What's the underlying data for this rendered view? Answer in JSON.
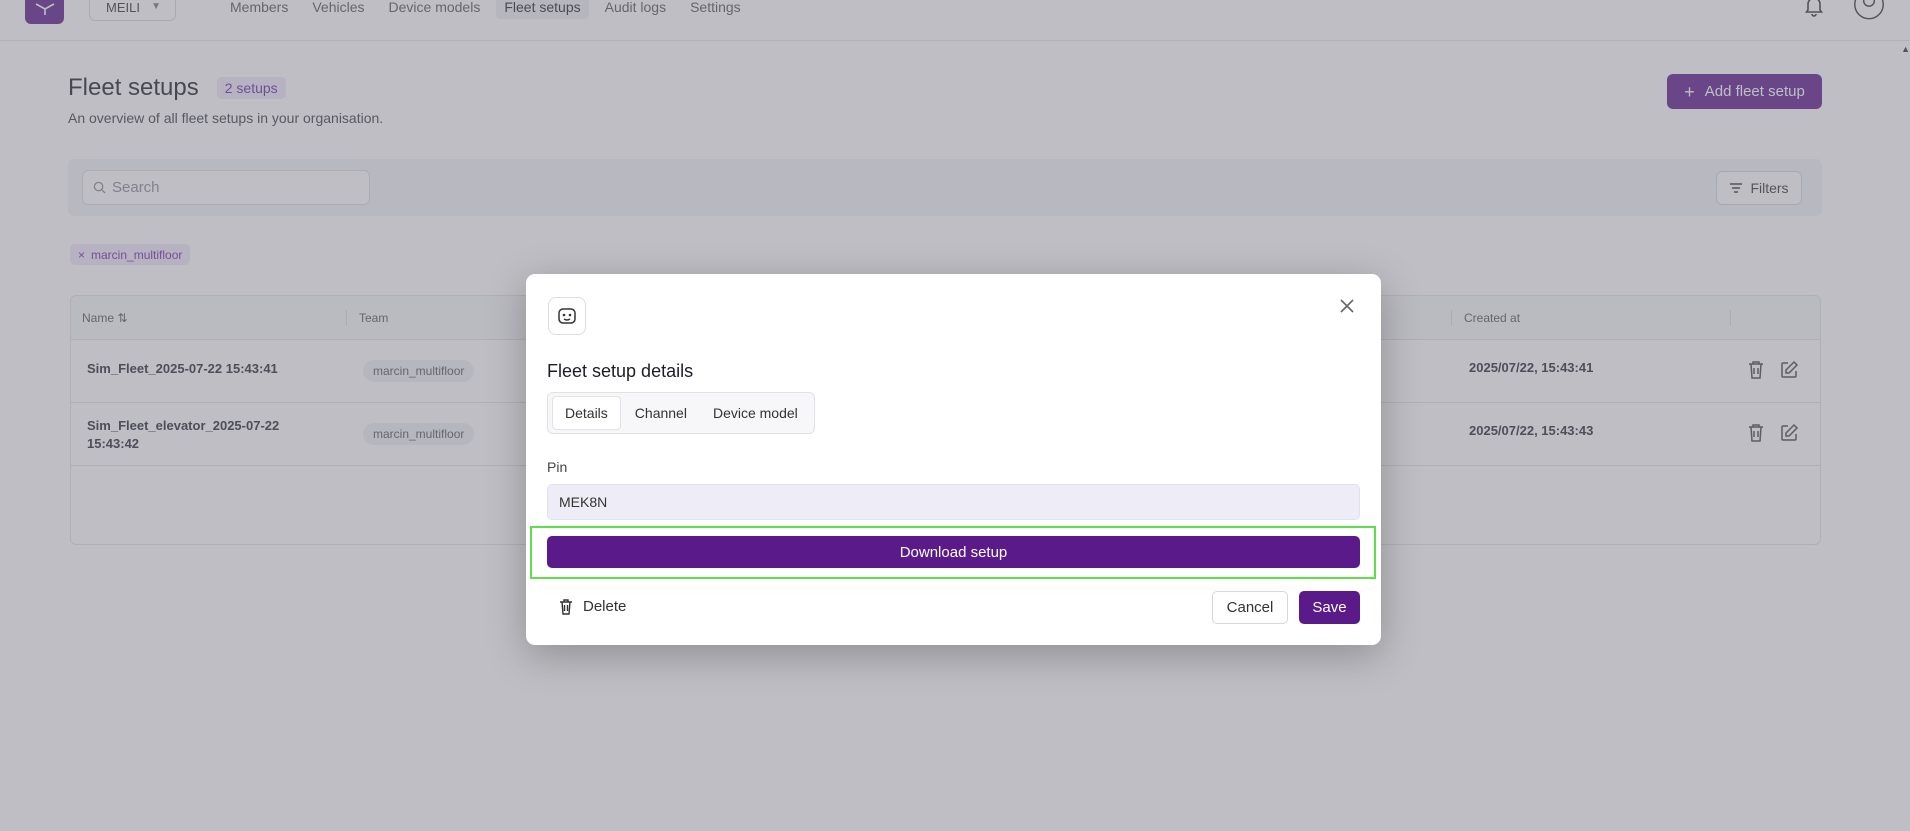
{
  "nav": {
    "org_name": "MEILI",
    "items": [
      "Members",
      "Vehicles",
      "Device models",
      "Fleet setups",
      "Audit logs",
      "Settings"
    ],
    "active": "Fleet setups"
  },
  "page": {
    "title": "Fleet setups",
    "count_badge": "2 setups",
    "subtitle": "An overview of all fleet setups in your organisation.",
    "add_button": "Add fleet setup"
  },
  "search": {
    "placeholder": "Search"
  },
  "filters_button": "Filters",
  "active_filter_chip": "marcin_multifloor",
  "table": {
    "columns": {
      "name": "Name",
      "team": "Team",
      "created_at": "Created at"
    },
    "rows": [
      {
        "name": "Sim_Fleet_2025-07-22 15:43:41",
        "team": "marcin_multifloor",
        "created_at": "2025/07/22, 15:43:41"
      },
      {
        "name": "Sim_Fleet_elevator_2025-07-22 15:43:42",
        "team": "marcin_multifloor",
        "created_at": "2025/07/22, 15:43:43"
      }
    ]
  },
  "modal": {
    "title": "Fleet setup details",
    "tabs": [
      "Details",
      "Channel",
      "Device model"
    ],
    "active_tab": "Details",
    "pin_label": "Pin",
    "pin_value": "MEK8N",
    "download_button": "Download setup",
    "delete_button": "Delete",
    "cancel_button": "Cancel",
    "save_button": "Save"
  },
  "colors": {
    "brand": "#5b1a8a",
    "highlight": "#5fe04a"
  }
}
